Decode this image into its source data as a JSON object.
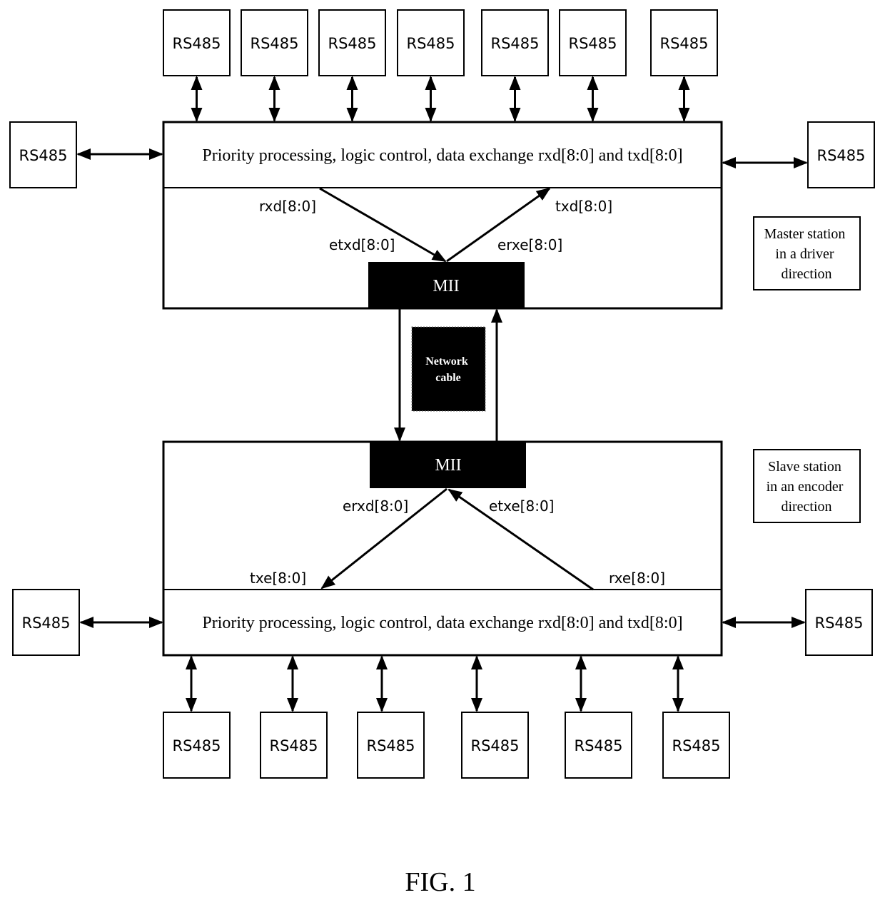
{
  "figure_caption": "FIG. 1",
  "master": {
    "logic_label": "Priority processing, logic control, data exchange rxd[8:0] and txd[8:0]",
    "mii_label": "MII",
    "signals": {
      "rxd": "rxd[8:0]",
      "txd": "txd[8:0]",
      "etxd": "etxd[8:0]",
      "erxe": "erxe[8:0]"
    },
    "caption_lines": [
      "Master station",
      "in a driver",
      "direction"
    ]
  },
  "slave": {
    "logic_label": "Priority processing, logic control, data exchange rxd[8:0] and txd[8:0]",
    "mii_label": "MII",
    "signals": {
      "erxd": "erxd[8:0]",
      "etxe": "etxe[8:0]",
      "txe": "txe[8:0]",
      "rxe": "rxe[8:0]"
    },
    "caption_lines": [
      "Slave station",
      "in an encoder",
      "direction"
    ]
  },
  "network_cable": {
    "lines": [
      "Network",
      "cable"
    ]
  },
  "rs485_label": "RS485",
  "master_rs485": {
    "top_count": 7,
    "left_count": 1,
    "right_count": 1
  },
  "slave_rs485": {
    "bottom_count": 6,
    "left_count": 1,
    "right_count": 1
  }
}
